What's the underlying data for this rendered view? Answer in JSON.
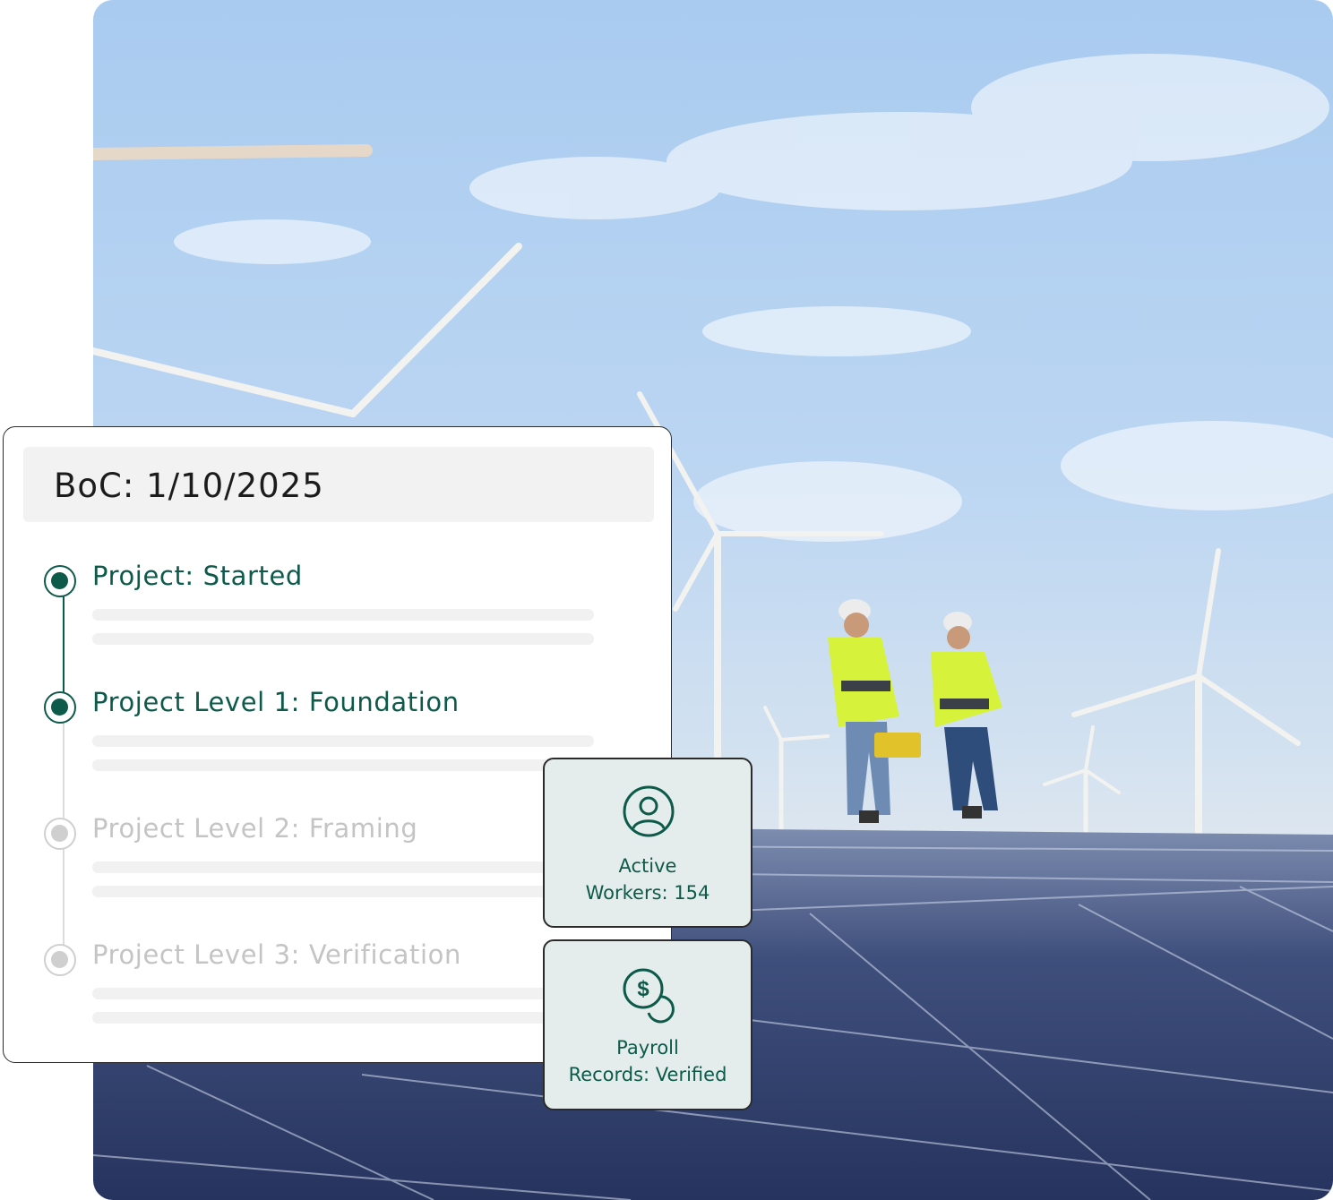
{
  "timeline": {
    "title": "BoC: 1/10/2025",
    "steps": [
      {
        "label": "Project: Started",
        "status": "complete"
      },
      {
        "label": "Project Level 1: Foundation",
        "status": "complete"
      },
      {
        "label": "Project Level 2: Framing",
        "status": "pending"
      },
      {
        "label": "Project Level 3: Verification",
        "status": "pending"
      }
    ]
  },
  "stats": {
    "workers": {
      "line1": "Active",
      "line2": "Workers: 154",
      "icon": "user-icon"
    },
    "payroll": {
      "line1": "Payroll",
      "line2": "Records: Verified",
      "icon": "dollar-coin-icon"
    }
  },
  "colors": {
    "accent": "#0d5a4b",
    "pending": "#c4c4c4",
    "tile_bg": "#e4edeb"
  }
}
